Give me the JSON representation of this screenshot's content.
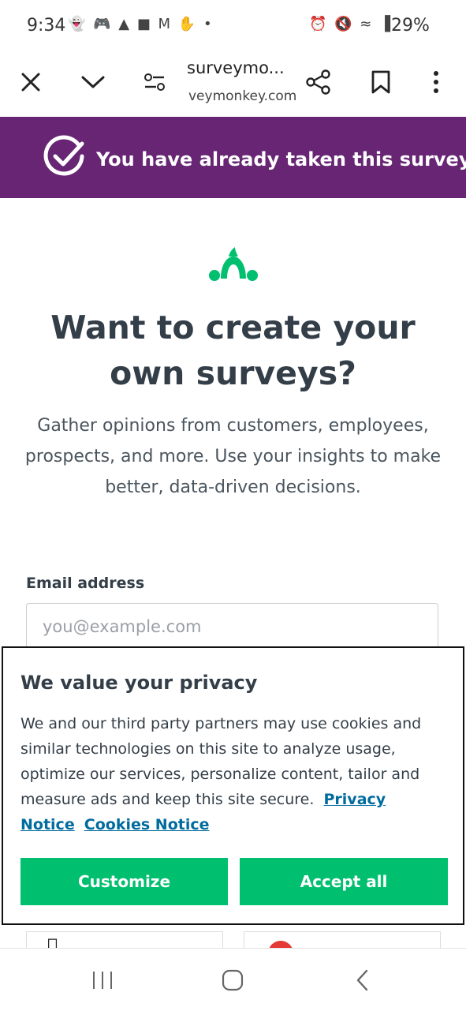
{
  "status_bar": {
    "time": "9:34",
    "left_icons": "👻 🎮 ▲ ■ M ✋ •",
    "right_icons": "⏰ 🔇 ≈ ▐",
    "battery": "29%"
  },
  "browser": {
    "title": "surveymo...",
    "domain": "veymonkey.com",
    "icons": [
      "close-icon",
      "chevron-down-icon",
      "page-settings-icon",
      "share-icon",
      "bookmark-icon",
      "more-vertical-icon"
    ]
  },
  "banner": {
    "text": "You have already taken this survey",
    "color": "#672574"
  },
  "main": {
    "headline": "Want to create your own surveys?",
    "subtext": "Gather opinions from customers, employees, prospects, and more. Use your insights to make better, data-driven decisions.",
    "email_label": "Email address",
    "email_placeholder": "you@example.com",
    "email_value": ""
  },
  "cookie": {
    "title": "We value your privacy",
    "body": "We and our third party partners may use cookies and similar technologies on this site to analyze usage, optimize our services, personalize content, tailor and measure ads and keep this site secure.",
    "privacy_link": "Privacy Notice",
    "cookies_link": "Cookies Notice",
    "customize_label": "Customize",
    "accept_label": "Accept all",
    "button_color": "#00bf6f"
  },
  "nav": {
    "icons": [
      "recent-apps-icon",
      "home-icon",
      "back-icon"
    ]
  }
}
